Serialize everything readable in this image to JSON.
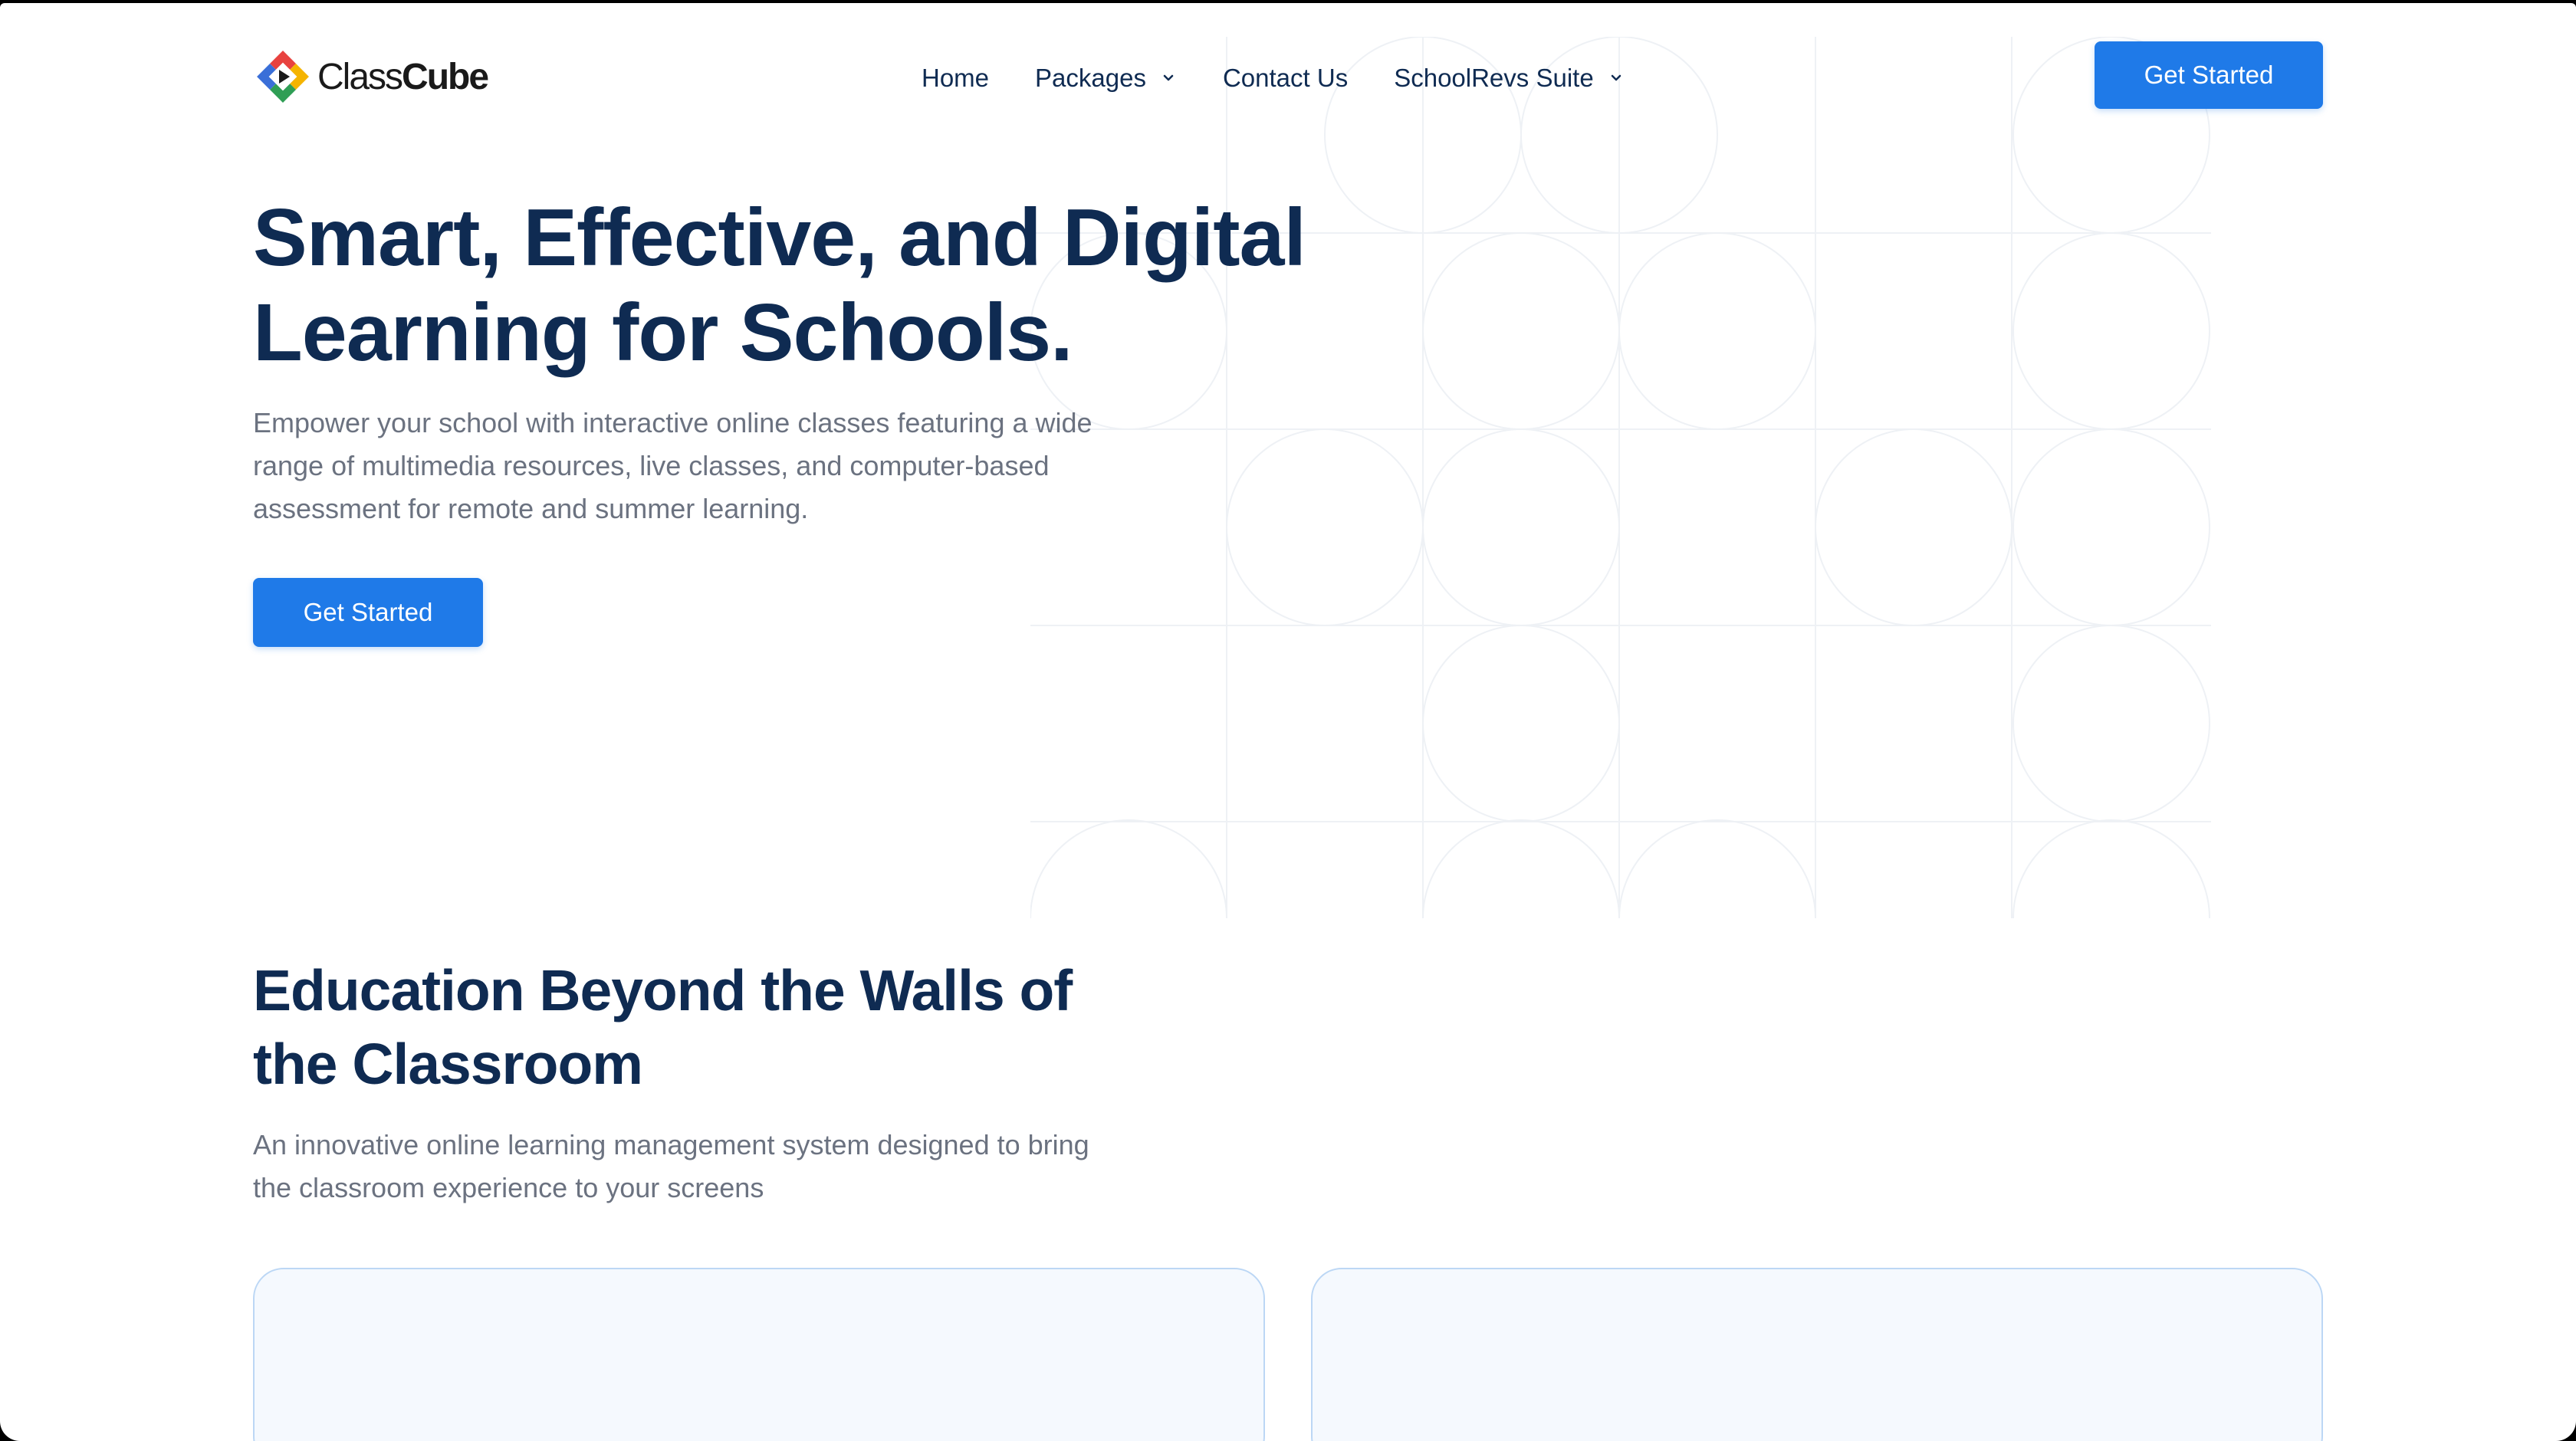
{
  "brand": {
    "name_part1": "Class",
    "name_part2": "Cube",
    "logo_colors": [
      "#e8423f",
      "#f5b400",
      "#2f9e55",
      "#3a6fd8"
    ]
  },
  "nav": {
    "items": [
      {
        "label": "Home",
        "has_dropdown": false
      },
      {
        "label": "Packages",
        "has_dropdown": true
      },
      {
        "label": "Contact Us",
        "has_dropdown": false
      },
      {
        "label": "SchoolRevs Suite",
        "has_dropdown": true
      }
    ],
    "cta_label": "Get Started"
  },
  "hero": {
    "title_line1": "Smart, Effective, and Digital",
    "title_line2": "Learning for Schools.",
    "subtitle": "Empower your school with interactive online classes featuring a wide range of multimedia resources, live classes, and computer-based assessment for remote and summer learning.",
    "cta_label": "Get Started"
  },
  "section": {
    "title_line1": "Education Beyond the Walls of",
    "title_line2": "the Classroom",
    "subtitle": "An innovative online learning management system designed to bring the classroom experience to your screens"
  },
  "colors": {
    "primary": "#1f7ae8",
    "heading": "#0f2b52",
    "body_text": "#6b7280",
    "card_bg": "#f5f9fe",
    "card_border": "#bcd7f5"
  }
}
